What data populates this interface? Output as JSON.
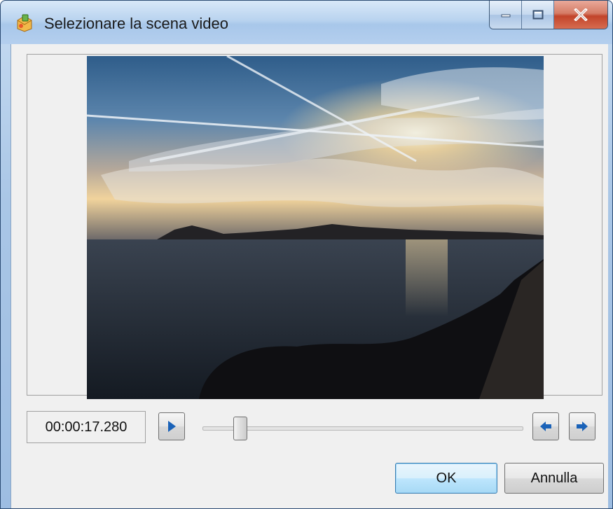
{
  "window": {
    "title": "Selezionare la scena video"
  },
  "player": {
    "timecode": "00:00:17.280",
    "position": 0.1
  },
  "buttons": {
    "ok_label": "OK",
    "cancel_label": "Annulla"
  },
  "colors": {
    "accent_blue": "#1a62b8",
    "default_button_border": "#3c7fb1",
    "dialog_background": "#f0f0f0"
  }
}
